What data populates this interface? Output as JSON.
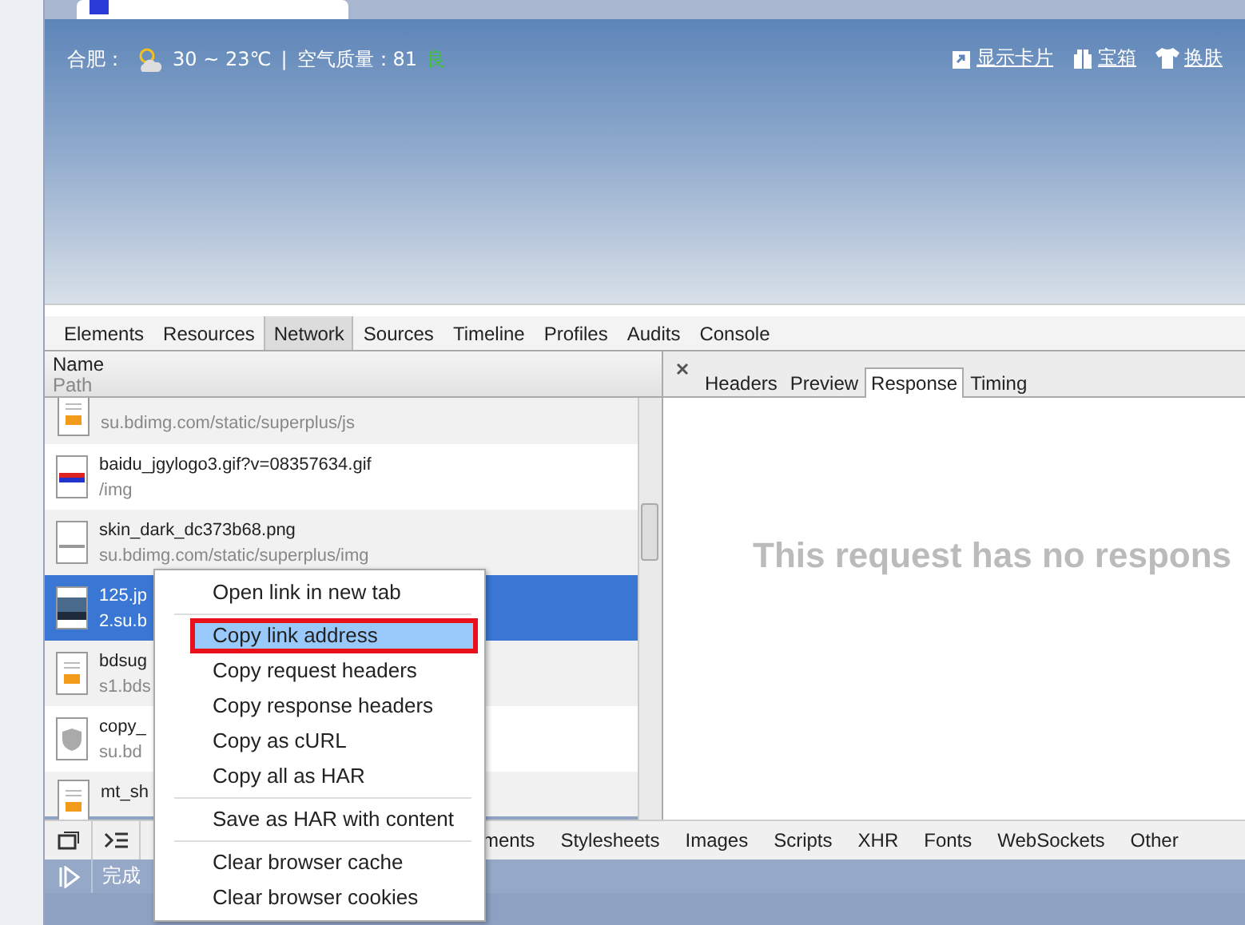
{
  "weather": {
    "city": "合肥：",
    "temp": "30 ~ 23℃",
    "sep": "|",
    "aqi": "空气质量：81",
    "aqi_level": "良"
  },
  "page_links": [
    {
      "kind": "card",
      "label": "显示卡片"
    },
    {
      "kind": "gift",
      "label": "宝箱"
    },
    {
      "kind": "skin",
      "label": "换肤"
    }
  ],
  "devtools_tabs": [
    {
      "label": "Elements",
      "selected": false
    },
    {
      "label": "Resources",
      "selected": false
    },
    {
      "label": "Network",
      "selected": true
    },
    {
      "label": "Sources",
      "selected": false
    },
    {
      "label": "Timeline",
      "selected": false
    },
    {
      "label": "Profiles",
      "selected": false
    },
    {
      "label": "Audits",
      "selected": false
    },
    {
      "label": "Console",
      "selected": false
    }
  ],
  "list_header": {
    "name": "Name",
    "path": "Path"
  },
  "requests": [
    {
      "kind": "js",
      "path": "su.bdimg.com/static/superplus/js",
      "selected": false
    },
    {
      "kind": "gif",
      "name": "baidu_jgylogo3.gif?v=08357634.gif",
      "path": "/img",
      "selected": false
    },
    {
      "kind": "png",
      "name": "skin_dark_dc373b68.png",
      "path": "su.bdimg.com/static/superplus/img",
      "selected": false
    },
    {
      "kind": "jpg",
      "name": "125.jp",
      "path": "2.su.b",
      "selected": true
    },
    {
      "kind": "js",
      "name": "bdsug",
      "path": "s1.bds",
      "selected": false
    },
    {
      "kind": "shield",
      "name": "copy_",
      "path": "su.bd",
      "selected": false
    },
    {
      "kind": "js",
      "name": "mt_sh",
      "selected": false
    }
  ],
  "detail_tabs": [
    {
      "label": "Headers",
      "selected": false
    },
    {
      "label": "Preview",
      "selected": false
    },
    {
      "label": "Response",
      "selected": true
    },
    {
      "label": "Timing",
      "selected": false
    }
  ],
  "response_message": "This request has no respons",
  "filters": [
    "ments",
    "Stylesheets",
    "Images",
    "Scripts",
    "XHR",
    "Fonts",
    "WebSockets",
    "Other"
  ],
  "status": "完成",
  "context_menu": [
    {
      "kind": "item",
      "label": "Open link in new tab",
      "selected": false
    },
    {
      "kind": "separator"
    },
    {
      "kind": "item",
      "label": "Copy link address",
      "selected": true
    },
    {
      "kind": "item",
      "label": "Copy request headers",
      "selected": false
    },
    {
      "kind": "item",
      "label": "Copy response headers",
      "selected": false
    },
    {
      "kind": "item",
      "label": "Copy as cURL",
      "selected": false
    },
    {
      "kind": "item",
      "label": "Copy all as HAR",
      "selected": false
    },
    {
      "kind": "separator"
    },
    {
      "kind": "item",
      "label": "Save as HAR with content",
      "selected": false
    },
    {
      "kind": "separator"
    },
    {
      "kind": "item",
      "label": "Clear browser cache",
      "selected": false
    },
    {
      "kind": "item",
      "label": "Clear browser cookies",
      "selected": false
    }
  ]
}
